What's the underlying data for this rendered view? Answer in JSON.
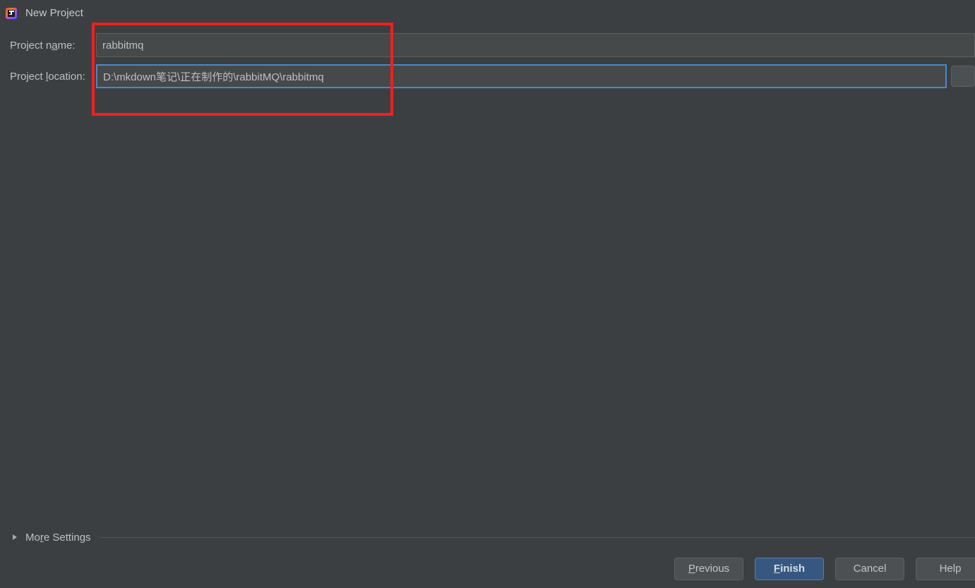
{
  "window": {
    "title": "New Project",
    "icon": "intellij-idea-icon"
  },
  "form": {
    "name_label_before": "Project n",
    "name_label_mnemonic": "a",
    "name_label_after": "me:",
    "name_label_full": "Project name:",
    "name_value": "rabbitmq",
    "name_placeholder": "",
    "location_label_before": "Project ",
    "location_label_mnemonic": "l",
    "location_label_after": "ocation:",
    "location_label_full": "Project location:",
    "location_value": "D:\\mkdown笔记\\正在制作的\\rabbitMQ\\rabbitmq",
    "location_placeholder": "",
    "browse_icon": "folder-browse-icon"
  },
  "more_settings": {
    "label_before": "Mo",
    "label_mnemonic": "r",
    "label_after": "e Settings",
    "label_full": "More Settings",
    "expanded": "false",
    "arrow_icon": "chevron-right-icon"
  },
  "buttons": {
    "previous": {
      "before": "",
      "mnemonic": "P",
      "after": "revious",
      "full": "Previous"
    },
    "finish": {
      "before": "",
      "mnemonic": "F",
      "after": "inish",
      "full": "Finish"
    },
    "cancel": {
      "before": "Cancel",
      "mnemonic": "",
      "after": "",
      "full": "Cancel"
    },
    "help": {
      "before": "Help",
      "mnemonic": "",
      "after": "",
      "full": "Help"
    }
  },
  "colors": {
    "background": "#3c3f41",
    "field_background": "#45494a",
    "focus_border": "#4a88c7",
    "primary_button": "#365880",
    "annotation": "#f02020",
    "text": "#bbbbbb"
  }
}
